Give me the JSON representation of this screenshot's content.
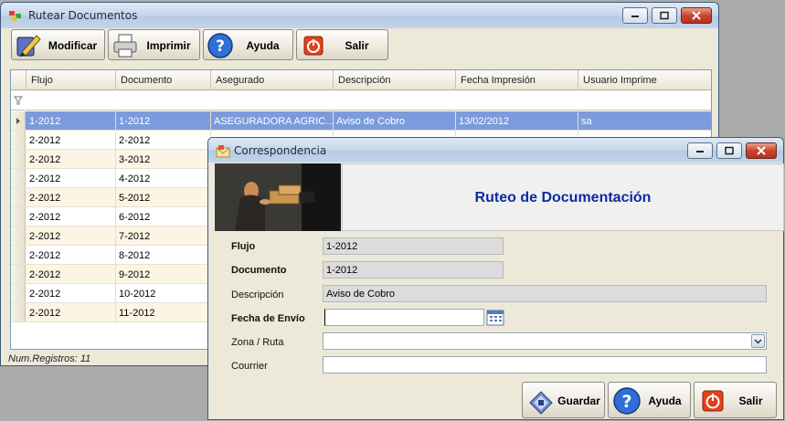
{
  "main_window": {
    "title": "Rutear Documentos",
    "toolbar": {
      "modificar": "Modificar",
      "imprimir": "Imprimir",
      "ayuda": "Ayuda",
      "salir": "Salir"
    },
    "grid": {
      "columns": [
        "Flujo",
        "Documento",
        "Asegurado",
        "Descripción",
        "Fecha Impresión",
        "Usuario Imprime"
      ],
      "rows": [
        [
          "1-2012",
          "1-2012",
          "ASEGURADORA AGRIC...",
          "Aviso de Cobro",
          "13/02/2012",
          "sa"
        ],
        [
          "2-2012",
          "2-2012",
          "",
          "",
          "",
          ""
        ],
        [
          "2-2012",
          "3-2012",
          "",
          "",
          "",
          ""
        ],
        [
          "2-2012",
          "4-2012",
          "",
          "",
          "",
          ""
        ],
        [
          "2-2012",
          "5-2012",
          "",
          "",
          "",
          ""
        ],
        [
          "2-2012",
          "6-2012",
          "",
          "",
          "",
          ""
        ],
        [
          "2-2012",
          "7-2012",
          "",
          "",
          "",
          ""
        ],
        [
          "2-2012",
          "8-2012",
          "",
          "",
          "",
          ""
        ],
        [
          "2-2012",
          "9-2012",
          "",
          "",
          "",
          ""
        ],
        [
          "2-2012",
          "10-2012",
          "",
          "",
          "",
          ""
        ],
        [
          "2-2012",
          "11-2012",
          "",
          "",
          "",
          ""
        ]
      ]
    },
    "status": "Num.Registros: 11"
  },
  "dialog": {
    "title": "Correspondencia",
    "header_title": "Ruteo de Documentación",
    "fields": {
      "flujo_label": "Flujo",
      "flujo_value": "1-2012",
      "documento_label": "Documento",
      "documento_value": "1-2012",
      "descripcion_label": "Descripción",
      "descripcion_value": "Aviso de Cobro",
      "fecha_label": "Fecha de Envío",
      "fecha_value": "",
      "zona_label": "Zona / Ruta",
      "zona_value": "",
      "courrier_label": "Courrier",
      "courrier_value": ""
    },
    "buttons": {
      "guardar": "Guardar",
      "ayuda": "Ayuda",
      "salir": "Salir"
    }
  },
  "colors": {
    "selected_row": "#7b9bdc",
    "alt_row": "#fdf5e4",
    "header_title": "#0b2aa8",
    "readonly_field": "#dcdcdc"
  }
}
